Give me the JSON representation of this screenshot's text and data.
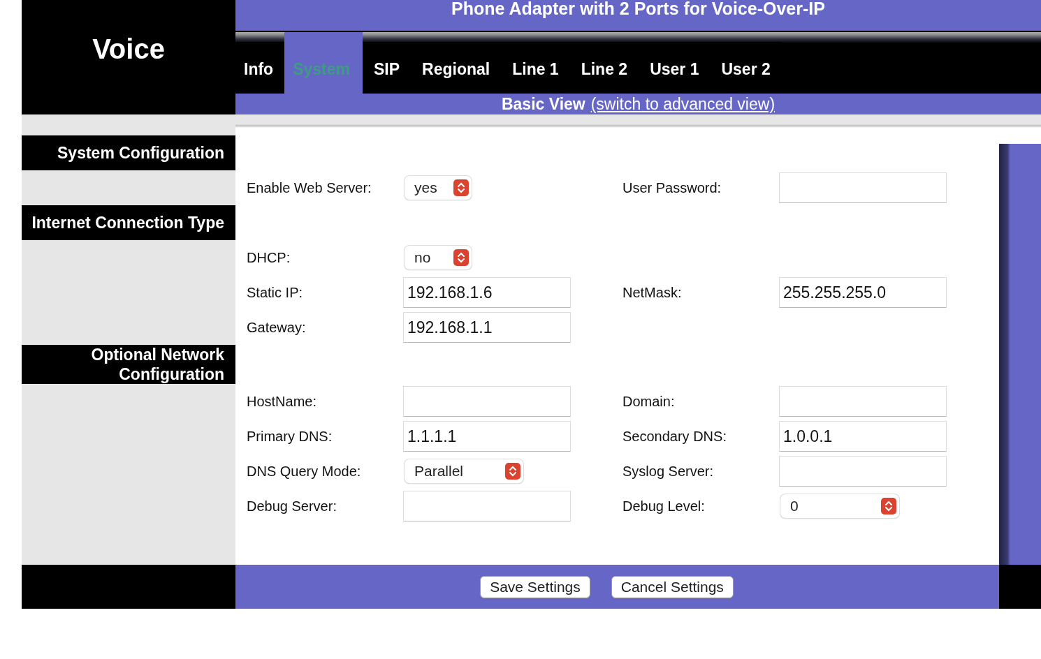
{
  "brand": "Voice",
  "title": "Phone Adapter with 2 Ports for Voice-Over-IP",
  "tabs": [
    {
      "label": "Info",
      "selected": false
    },
    {
      "label": "System",
      "selected": true
    },
    {
      "label": "SIP",
      "selected": false
    },
    {
      "label": "Regional",
      "selected": false
    },
    {
      "label": "Line 1",
      "selected": false
    },
    {
      "label": "Line 2",
      "selected": false
    },
    {
      "label": "User 1",
      "selected": false
    },
    {
      "label": "User 2",
      "selected": false
    }
  ],
  "view": {
    "label": "Basic View",
    "link": "(switch to advanced view)"
  },
  "sections": [
    {
      "title": "System Configuration",
      "rows": [
        [
          {
            "label": "Enable Web Server:",
            "kind": "select",
            "value": "yes"
          },
          {
            "label": "User Password:",
            "kind": "text"
          }
        ]
      ]
    },
    {
      "title": "Internet Connection Type",
      "rows": [
        [
          {
            "label": "DHCP:",
            "kind": "select",
            "value": "no"
          }
        ],
        [
          {
            "label": "Static IP:",
            "kind": "text",
            "value": "192.168.1.6"
          },
          {
            "label": "NetMask:",
            "kind": "text",
            "value": "255.255.255.0"
          }
        ],
        [
          {
            "label": "Gateway:",
            "kind": "text",
            "value": "192.168.1.1"
          }
        ]
      ]
    },
    {
      "title": "Optional Network Configuration",
      "rows": [
        [
          {
            "label": "HostName:",
            "kind": "text"
          },
          {
            "label": "Domain:",
            "kind": "text"
          }
        ],
        [
          {
            "label": "Primary DNS:",
            "kind": "text",
            "value": "1.1.1.1"
          },
          {
            "label": "Secondary DNS:",
            "kind": "text",
            "value": "1.0.0.1"
          }
        ],
        [
          {
            "label": "DNS Query Mode:",
            "kind": "select",
            "value": "Parallel",
            "wide": true
          },
          {
            "label": "Syslog Server:",
            "kind": "text"
          }
        ],
        [
          {
            "label": "Debug Server:",
            "kind": "text"
          },
          {
            "label": "Debug Level:",
            "kind": "select",
            "value": "0",
            "wide": true
          }
        ]
      ]
    }
  ],
  "buttons": [
    "Save Settings",
    "Cancel Settings"
  ]
}
